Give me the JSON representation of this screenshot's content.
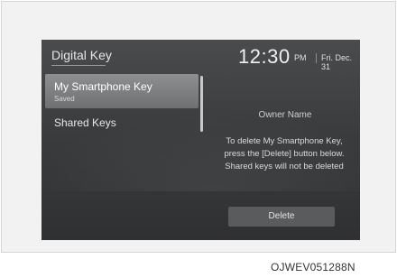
{
  "screen": {
    "title": "Digital Key",
    "time": "12:30",
    "ampm": "PM",
    "date": "Fri. Dec. 31"
  },
  "list": {
    "items": [
      {
        "label": "My Smartphone Key",
        "sub": "Saved",
        "selected": true
      },
      {
        "label": "Shared Keys",
        "selected": false
      }
    ]
  },
  "detail": {
    "owner_label": "Owner Name",
    "message_lines": [
      "To delete My Smartphone Key,",
      "press the [Delete] button below.",
      "Shared keys will not be deleted"
    ],
    "delete_label": "Delete"
  },
  "caption": "OJWEV051288N",
  "colors": {
    "screen_bg": "#3b3c3e",
    "selected_item": "#7f8082",
    "button": "#5a5b5d"
  }
}
